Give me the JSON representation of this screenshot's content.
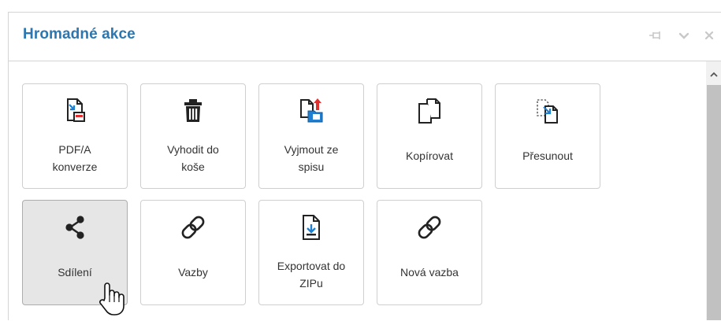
{
  "panel": {
    "title": "Hromadné akce",
    "header_icons": [
      "pin-icon",
      "chevron-down-icon",
      "close-icon"
    ]
  },
  "actions": [
    {
      "label": "PDF/A\nkonverze",
      "icon": "pdf-convert-icon"
    },
    {
      "label": "Vyhodit do\nkoše",
      "icon": "trash-icon"
    },
    {
      "label": "Vyjmout ze\nspisu",
      "icon": "remove-from-file-icon"
    },
    {
      "label": "Kopírovat",
      "icon": "copy-icon"
    },
    {
      "label": "Přesunout",
      "icon": "move-icon"
    },
    {
      "label": "Sdílení",
      "icon": "share-icon",
      "active": true
    },
    {
      "label": "Vazby",
      "icon": "link-icon"
    },
    {
      "label": "Exportovat do\nZIPu",
      "icon": "export-zip-icon"
    },
    {
      "label": "Nová vazba",
      "icon": "link-icon"
    }
  ],
  "colors": {
    "title": "#2a77b2",
    "active_button_bg": "#e6e6e6",
    "icon_accent_red": "#e03030",
    "icon_accent_blue": "#1f7fd0"
  }
}
